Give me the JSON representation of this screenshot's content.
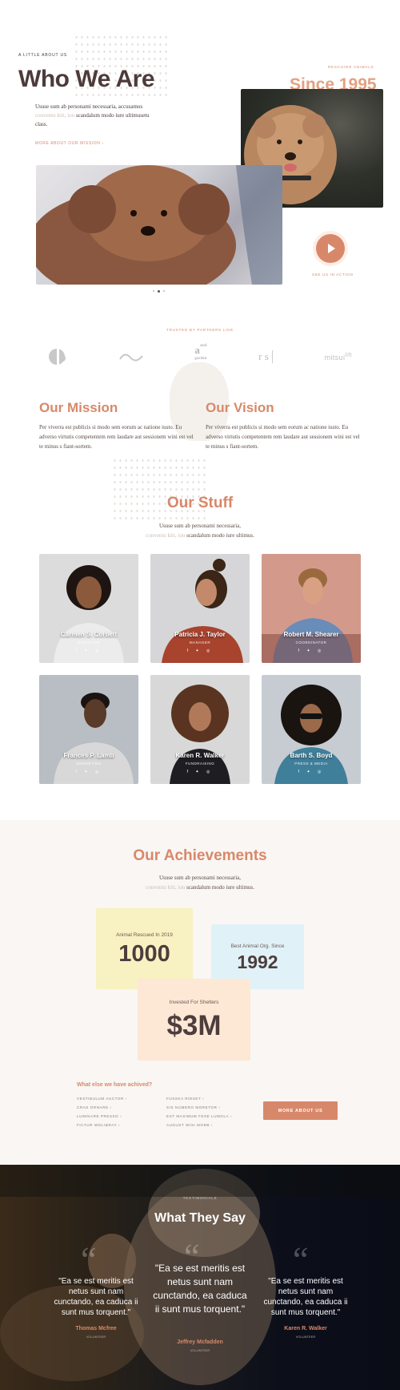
{
  "hero": {
    "kicker": "A LITTLE ABOUT US",
    "title": "Who We Are",
    "text_line1": "Ususe sum ab personami necessaria, accusamos",
    "text_line2_faded": "conventu kitt, ion",
    "text_line2": "scandalum modo iure ultimusetu",
    "text_line3": "class.",
    "more_link": "MORE ABOUT OUR MISSION  ›",
    "rescuing": "RESCUING ANIMALS",
    "since": "Since 1995",
    "see_us": "SEE US IN ACTION"
  },
  "partners": {
    "label": "TRUSTED BY PARTNERS LIKE",
    "logos": [
      "c-logo",
      "wave-logo",
      "asoul garden",
      "rs-logo",
      "mitsui lift"
    ]
  },
  "mission": {
    "title": "Our Mission",
    "text": "Per viverra est publicis si modo sem eorum ac natione iusto. Eu adverso virtutis competentem rem laudare aut sessionem wini est vel te minus s fiant-sortem."
  },
  "vision": {
    "title": "Our Vision",
    "text": "Per viverra est publicis si modo sem eorum ac natione iusto. Eu adverso virtutis competentem rem laudare aut sessionem wini est vel te minus s fiant-sortem."
  },
  "staff": {
    "title": "Our Stuff",
    "sub1": "Ususe sum ab personami necessaria,",
    "sub2_faded": "conventu kitt, ion",
    "sub2": "scandalum modo iure ultimus.",
    "social": "f ✦ ◎",
    "members": [
      {
        "name": "Carmen S. Corbett",
        "role": "DIRECTOR"
      },
      {
        "name": "Patricia J. Taylor",
        "role": "MANAGER"
      },
      {
        "name": "Robert M. Shearer",
        "role": "COORDINATOR"
      },
      {
        "name": "Frances P. Lamb",
        "role": "MARKETING"
      },
      {
        "name": "Karen R. Walker",
        "role": "FUNDRAISING"
      },
      {
        "name": "Barth S. Boyd",
        "role": "PRESS & MEDIA"
      }
    ]
  },
  "achievements": {
    "title": "Our Achievements",
    "sub1": "Ususe sum ab personami necessaria,",
    "sub2_faded": "conventu kitt, ion",
    "sub2": "scandalum modo iure ultimus.",
    "stats": [
      {
        "label": "Animal Rescued In 2019",
        "value": "1000",
        "color": "#f8f1c2"
      },
      {
        "label": "Best Animal Org. Since",
        "value": "1992",
        "color": "#e0f2f8"
      },
      {
        "label": "Invested For Shelters",
        "value": "$3M",
        "color": "#fde8d6"
      }
    ],
    "else_title": "What else we have achived?",
    "links_col1": [
      "VESTIBULUM AUCTOR  ›",
      "CRAS ORNARE  ›",
      "LUMINARE PRESSO  ›",
      "FICTUR WOLIBRAY  ›"
    ],
    "links_col2": [
      "FUSSKA RIDSET  ›",
      "SIS NUMERO MORETOR  ›",
      "EST MAXIMUM FESE LUMOLA  ›",
      "AUGUST WISI MORB  ›"
    ],
    "button": "MORE ABOUT US"
  },
  "testimonials": {
    "kicker": "TESTIMONIALS",
    "title": "What They Say",
    "items": [
      {
        "quote": "\"Ea se est meritis est netus sunt nam cunctando, ea caduca ii sunt mus torquent.\"",
        "name": "Thomas Mcfree",
        "role": "VOLUNTEER"
      },
      {
        "quote": "\"Ea se est meritis est netus sunt nam cunctando, ea caduca ii sunt mus torquent.\"",
        "name": "Jeffrey Mcfadden",
        "role": "VOLUNTEER"
      },
      {
        "quote": "\"Ea se est meritis est netus sunt nam cunctando, ea caduca ii sunt mus torquent.\"",
        "name": "Karen R. Walker",
        "role": "VOLUNTEER"
      }
    ]
  },
  "colors": {
    "accent": "#d8886a",
    "text": "#4a3a3a",
    "cream": "#f9f6f3",
    "dark": "#0c0f1a"
  }
}
